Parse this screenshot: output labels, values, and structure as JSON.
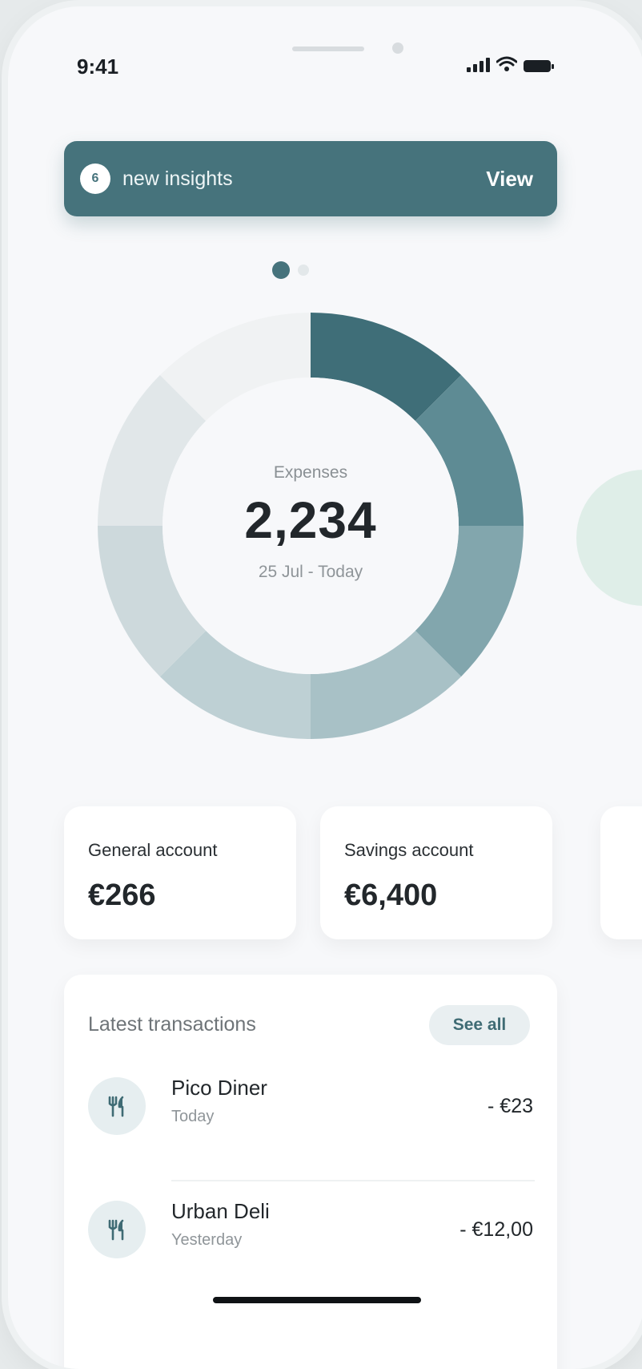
{
  "status_bar": {
    "time": "9:41"
  },
  "insights": {
    "count": "6",
    "text": "new insights",
    "action": "View"
  },
  "chart_data": {
    "type": "pie",
    "center": {
      "label": "Expenses",
      "value": "2,234",
      "range": "25 Jul - Today"
    },
    "segment_colors": [
      "#3f6e78",
      "#5e8b94",
      "#82a6ad",
      "#a8c1c6",
      "#bed0d4",
      "#cdd9dc",
      "#e1e7e9",
      "#f0f2f3"
    ]
  },
  "accounts": [
    {
      "label": "General account",
      "value": "€266"
    },
    {
      "label": "Savings account",
      "value": "€6,400"
    }
  ],
  "transactions": {
    "title": "Latest transactions",
    "see_all": "See all",
    "items": [
      {
        "name": "Pico Diner",
        "date": "Today",
        "amount": "- €23",
        "icon": "utensils-icon"
      },
      {
        "name": "Urban Deli",
        "date": "Yesterday",
        "amount": "- €12,00",
        "icon": "utensils-icon"
      }
    ]
  }
}
